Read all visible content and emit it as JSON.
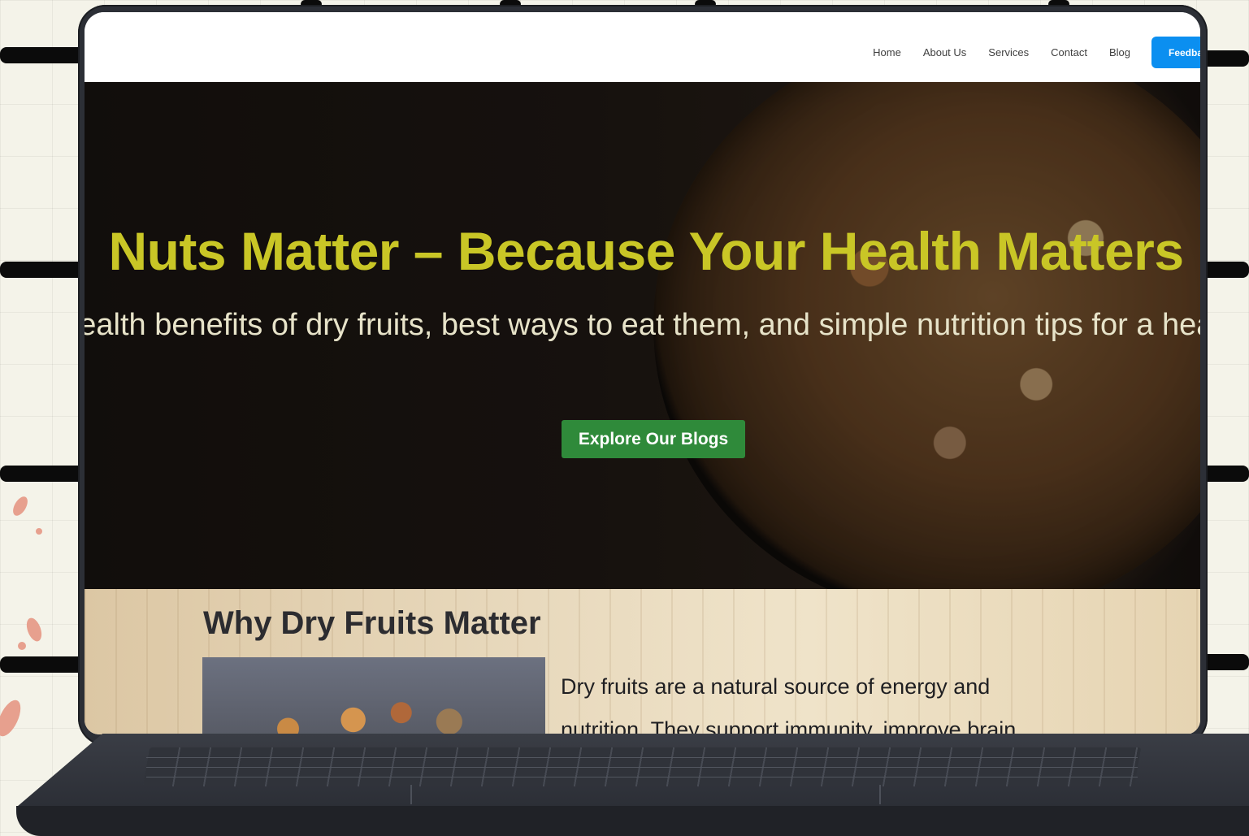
{
  "nav": {
    "links": [
      "Home",
      "About Us",
      "Services",
      "Contact",
      "Blog"
    ],
    "feedback_label": "Feedback"
  },
  "hero": {
    "title": "Nuts Matter – Because Your Health Matters",
    "subtitle": "Discover the health benefits of dry fruits, best ways to eat them, and simple nutrition tips for a healthier lifestyle.",
    "cta_label": "Explore Our Blogs"
  },
  "section": {
    "title": "Why Dry Fruits Matter",
    "text": "Dry fruits are a natural source of energy and nutrition. They support immunity, improve brain"
  },
  "colors": {
    "accent_blue": "#0b8ff0",
    "title_yellow": "#c9c626",
    "cta_green": "#2f8a3a"
  }
}
